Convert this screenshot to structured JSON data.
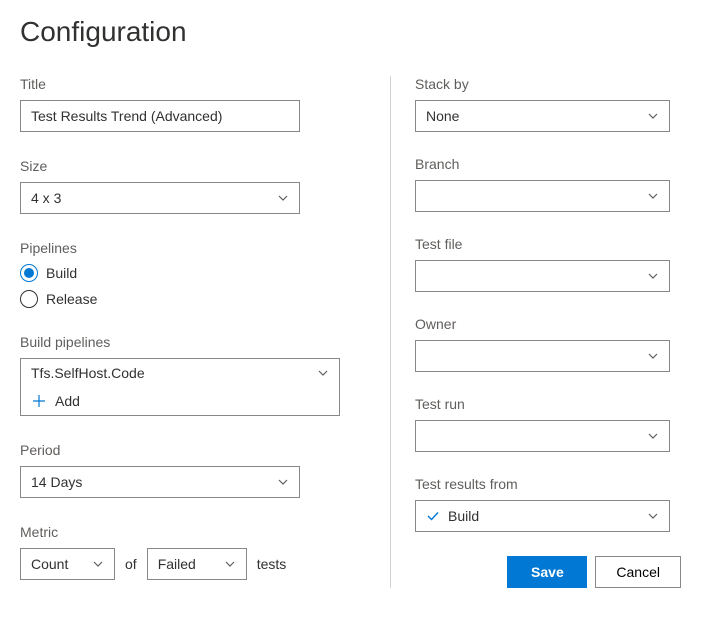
{
  "page_title": "Configuration",
  "left": {
    "title": {
      "label": "Title",
      "value": "Test Results Trend (Advanced)"
    },
    "size": {
      "label": "Size",
      "value": "4 x 3"
    },
    "pipelines": {
      "label": "Pipelines",
      "options": [
        "Build",
        "Release"
      ],
      "selected": "Build"
    },
    "build_pipelines": {
      "label": "Build pipelines",
      "value": "Tfs.SelfHost.Code",
      "add_label": "Add"
    },
    "period": {
      "label": "Period",
      "value": "14 Days"
    },
    "metric": {
      "label": "Metric",
      "count_value": "Count",
      "of_label": "of",
      "status_value": "Failed",
      "tests_label": "tests"
    }
  },
  "right": {
    "stack_by": {
      "label": "Stack by",
      "value": "None"
    },
    "branch": {
      "label": "Branch",
      "value": ""
    },
    "test_file": {
      "label": "Test file",
      "value": ""
    },
    "owner": {
      "label": "Owner",
      "value": ""
    },
    "test_run": {
      "label": "Test run",
      "value": ""
    },
    "test_results_from": {
      "label": "Test results from",
      "value": "Build"
    }
  },
  "actions": {
    "save": "Save",
    "cancel": "Cancel"
  }
}
